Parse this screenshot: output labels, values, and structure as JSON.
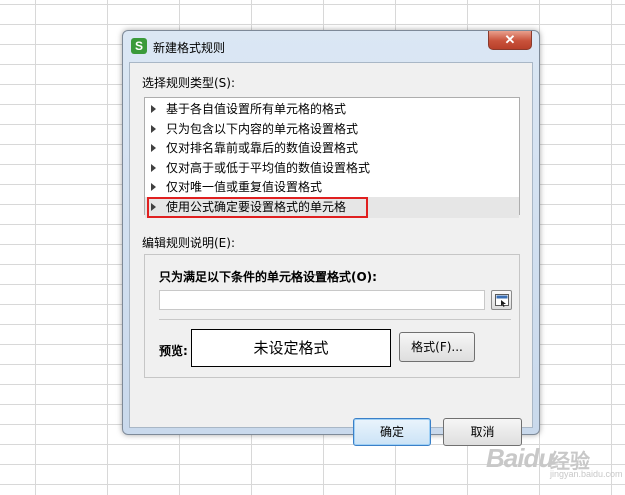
{
  "dialog": {
    "title": "新建格式规则",
    "app_icon_letter": "S",
    "close_glyph": "✕"
  },
  "select_rule": {
    "label": "选择规则类型(S):",
    "items": [
      {
        "label": "基于各自值设置所有单元格的格式"
      },
      {
        "label": "只为包含以下内容的单元格设置格式"
      },
      {
        "label": "仅对排名靠前或靠后的数值设置格式"
      },
      {
        "label": "仅对高于或低于平均值的数值设置格式"
      },
      {
        "label": "仅对唯一值或重复值设置格式"
      },
      {
        "label": "使用公式确定要设置格式的单元格"
      }
    ],
    "selected_index": 5,
    "highlight_color": "#e02020"
  },
  "edit_rule": {
    "label": "编辑规则说明(E):",
    "condition_label": "只为满足以下条件的单元格设置格式(O):",
    "formula_value": "",
    "preview_label": "预览:",
    "preview_text": "未设定格式",
    "format_button": "格式(F)..."
  },
  "footer": {
    "ok_button": "确定",
    "cancel_button": "取消"
  },
  "watermark": {
    "logo": "Baidu",
    "text": "经验",
    "url": "jingyan.baidu.com"
  },
  "colors": {
    "dialog_frame": "#c9d9ec",
    "client": "#f0f0f0",
    "close_button": "#c8513a",
    "default_button_border": "#3a80c8"
  }
}
